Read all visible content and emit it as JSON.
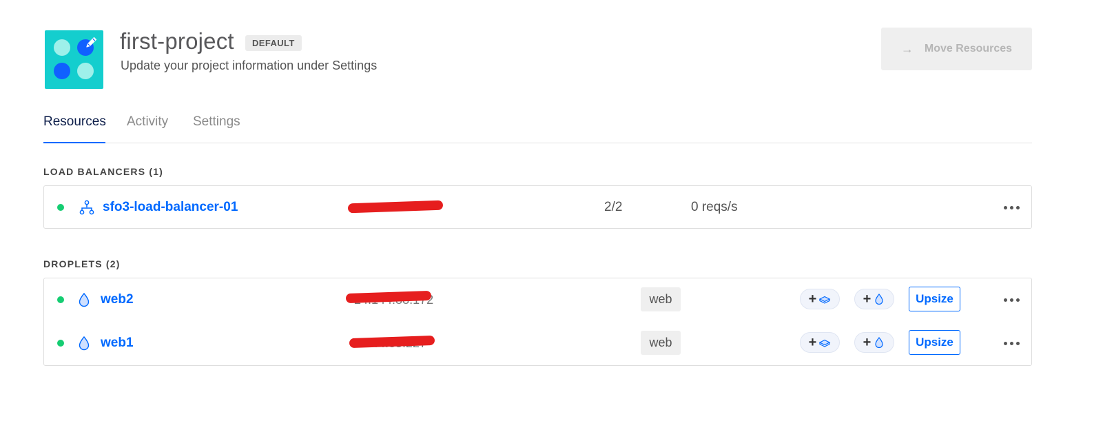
{
  "project": {
    "title": "first-project",
    "badge": "DEFAULT",
    "subtitle": "Update your project information under Settings",
    "logo_icon": "project-logo-icon",
    "edit_icon": "pencil-icon"
  },
  "header": {
    "move_resources_label": "Move Resources",
    "move_arrow": "→"
  },
  "tabs": [
    {
      "label": "Resources",
      "active": true
    },
    {
      "label": "Activity",
      "active": false
    },
    {
      "label": "Settings",
      "active": false
    }
  ],
  "load_balancers": {
    "section_label": "LOAD BALANCERS (1)",
    "items": [
      {
        "name": "sfo3-load-balancer-01",
        "status": "active",
        "ip": "redacted",
        "nodes": "2/2",
        "requests": "0 reqs/s",
        "icon": "load-balancer-icon"
      }
    ]
  },
  "droplets": {
    "section_label": "DROPLETS (2)",
    "items": [
      {
        "name": "web2",
        "status": "active",
        "ip_visible_fragment": "24.144.88.172",
        "tag": "web",
        "add_volume_label": "+",
        "add_droplet_label": "+",
        "upsize_label": "Upsize",
        "icon": "droplet-icon"
      },
      {
        "name": "web1",
        "status": "active",
        "ip_visible_fragment": ".44.85.227",
        "tag": "web",
        "add_volume_label": "+",
        "add_droplet_label": "+",
        "upsize_label": "Upsize",
        "icon": "droplet-icon"
      }
    ]
  },
  "colors": {
    "accent": "#0069ff",
    "status_active": "#15cd72",
    "logo_bg": "#14cece",
    "redaction": "#e61e1e"
  }
}
